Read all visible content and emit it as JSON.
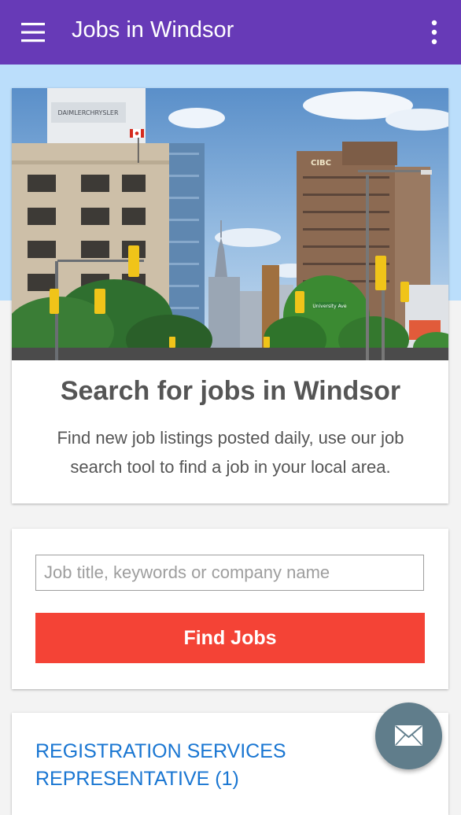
{
  "app_bar": {
    "title": "Jobs in Windsor",
    "menu_icon": "hamburger-menu-icon",
    "overflow_icon": "more-vert-icon",
    "color": "#673ab7"
  },
  "hero": {
    "title": "Search for jobs in Windsor",
    "description": "Find new job listings posted daily, use our job search tool to find a job in your local area.",
    "background_color": "#bbdefb"
  },
  "search": {
    "placeholder": "Job title, keywords or company name",
    "value": "",
    "button_label": "Find Jobs",
    "button_color": "#f44336"
  },
  "jobs": [
    {
      "title": "REGISTRATION SERVICES REPRESENTATIVE (1)"
    }
  ],
  "fab": {
    "icon": "mail-icon",
    "color": "#607d8b"
  }
}
